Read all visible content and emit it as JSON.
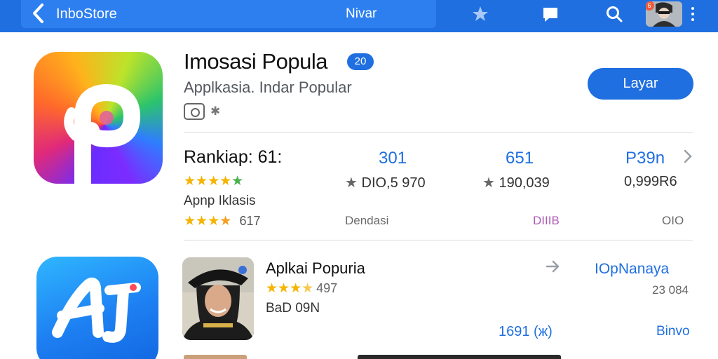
{
  "topbar": {
    "store_name": "InboStore",
    "nav_title": "Nivar",
    "notification_count": "6",
    "icons": [
      "back-arrow-icon",
      "star-icon",
      "chat-bubble-icon",
      "search-icon",
      "more-vert-icon"
    ]
  },
  "app": {
    "name": "Imosasi Popula",
    "badge": "20",
    "subtitle": "Applkasia. Indar Popular",
    "get_label": "Layar"
  },
  "stats": {
    "rank_title": "Rankiap: 61:",
    "rank_stars": "★★★★★",
    "row_label": "Apnp Iklasis",
    "row_rating": "617",
    "columns": [
      {
        "value": "301",
        "sub": "DIO,5 970",
        "foot": "Dendasi"
      },
      {
        "value": "651",
        "sub": "190,039",
        "foot": "DIIIB"
      },
      {
        "value": "P39n",
        "sub": "0,999R6",
        "foot": "OIO"
      }
    ]
  },
  "featured": {
    "title": "Aplkai Popuria",
    "rating": "497",
    "meta": "BaD 09N",
    "link": "IOpNanaya",
    "count": "23 084",
    "size": "1691 (ж)",
    "action": "Binvo"
  },
  "colors": {
    "accent": "#1f6fe0",
    "star": "#f5b400",
    "text": "#111111",
    "muted": "#55595f"
  }
}
